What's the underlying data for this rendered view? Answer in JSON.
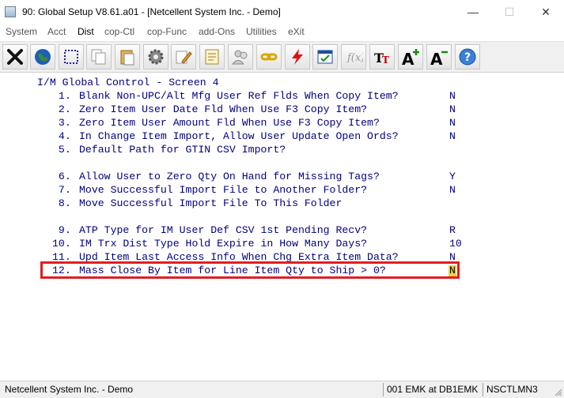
{
  "window": {
    "title": "90: Global Setup V8.61.a01 - [Netcellent System Inc. - Demo]",
    "minimize": "—",
    "maximize": "☐",
    "close": "✕"
  },
  "menu": [
    "System",
    "Acct",
    "Dist",
    "cop-Ctl",
    "cop-Func",
    "add-Ons",
    "Utilities",
    "eXit"
  ],
  "toolbar": {
    "icons": [
      "exit-icon",
      "globe-icon",
      "select-icon",
      "copy-icon",
      "paste-icon",
      "settings-gear-icon",
      "edit-pencil-icon",
      "notes-icon",
      "users-icon",
      "link-chain-icon",
      "lightning-icon",
      "window-check-icon",
      "formula-icon",
      "text-format-icon",
      "font-increase-icon",
      "font-decrease-icon",
      "help-icon"
    ]
  },
  "screen": {
    "title": "I/M Global Control - Screen 4",
    "items": [
      {
        "num": " 1.",
        "text": "Blank Non-UPC/Alt Mfg User Ref Flds When Copy Item?",
        "value": "N"
      },
      {
        "num": " 2.",
        "text": "Zero Item User Date Fld When Use F3 Copy Item?",
        "value": "N"
      },
      {
        "num": " 3.",
        "text": "Zero Item User Amount Fld When Use F3 Copy Item?",
        "value": "N"
      },
      {
        "num": " 4.",
        "text": "In Change Item Import, Allow User Update Open Ords?",
        "value": "N"
      },
      {
        "num": " 5.",
        "text": "Default Path for GTIN CSV Import?",
        "value": ""
      },
      {
        "num": " 6.",
        "text": "Allow User to Zero Qty On Hand for Missing Tags?",
        "value": "Y"
      },
      {
        "num": " 7.",
        "text": "Move Successful Import File to Another Folder?",
        "value": "N"
      },
      {
        "num": " 8.",
        "text": "Move Successful Import File To This Folder",
        "value": ""
      },
      {
        "num": " 9.",
        "text": "ATP Type for IM User Def CSV 1st Pending Recv?",
        "value": "R"
      },
      {
        "num": "10.",
        "text": "IM Trx Dist Type Hold Expire in How Many Days?",
        "value": "10"
      },
      {
        "num": "11.",
        "text": "Upd Item Last Access Info When Chg Extra Item Data?",
        "value": "N"
      },
      {
        "num": "12.",
        "text": "Mass Close By Item for Line Item Qty to Ship > 0?",
        "value": "N"
      }
    ]
  },
  "status": {
    "company": "Netcellent System Inc. - Demo",
    "session": "001 EMK at DB1EMK",
    "program": "NSCTLMN3"
  }
}
